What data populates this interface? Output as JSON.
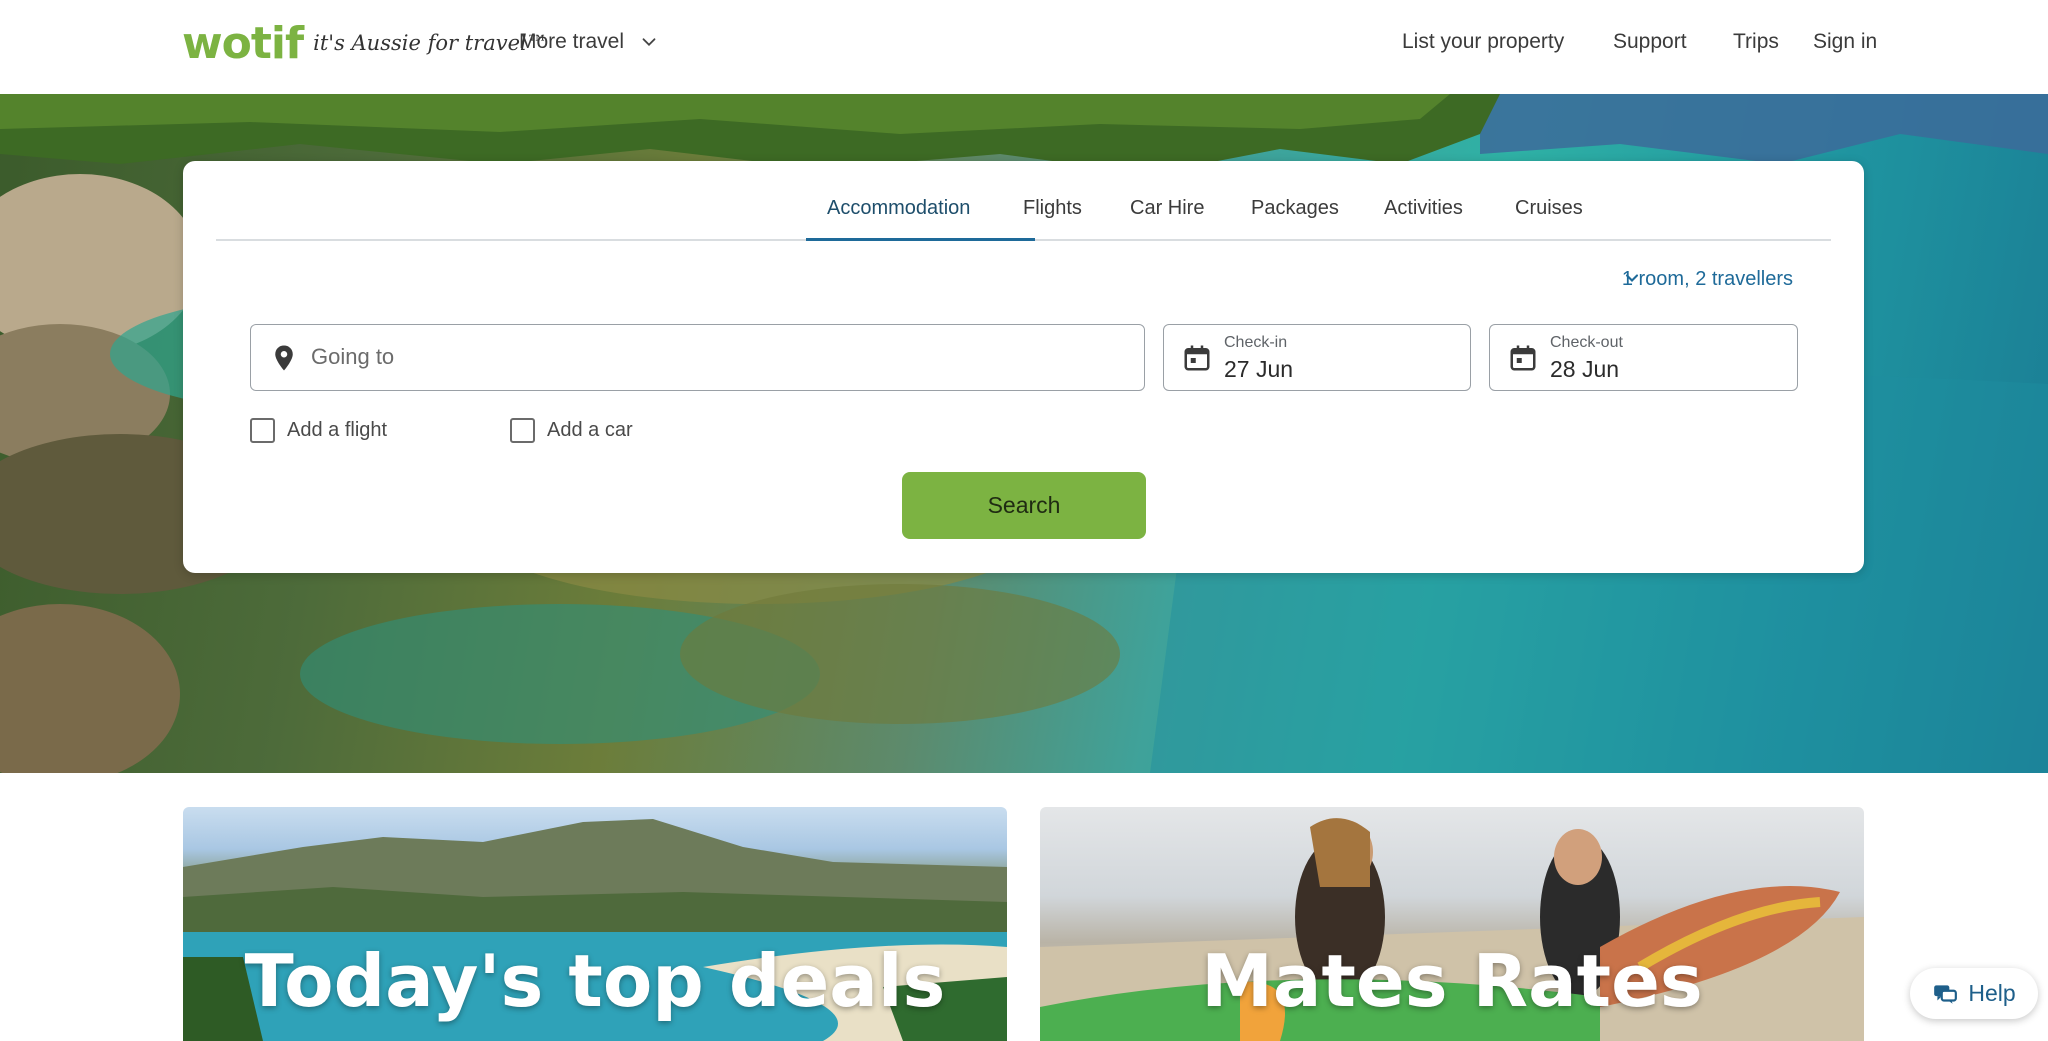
{
  "header": {
    "logo_word": "wotif",
    "logo_tagline": "it's Aussie for travel™",
    "more_travel": "More travel",
    "nav": [
      "List your property",
      "Support",
      "Trips",
      "Sign in"
    ]
  },
  "search": {
    "tabs": [
      "Accommodation",
      "Flights",
      "Car Hire",
      "Packages",
      "Activities",
      "Cruises"
    ],
    "active_tab": "Accommodation",
    "travellers": "1 room, 2 travellers",
    "going_to_placeholder": "Going to",
    "checkin_label": "Check-in",
    "checkin_value": "27 Jun",
    "checkout_label": "Check-out",
    "checkout_value": "28 Jun",
    "add_flight": "Add a flight",
    "add_car": "Add a car",
    "search_button": "Search"
  },
  "promos": [
    {
      "title": "Today's top deals"
    },
    {
      "title": "Mates Rates"
    }
  ],
  "help": {
    "label": "Help"
  },
  "colors": {
    "brand_green": "#7cb342",
    "accent_blue": "#1e6a99"
  },
  "icons": [
    "chevron-down-icon",
    "location-pin-icon",
    "calendar-icon",
    "chat-help-icon"
  ]
}
